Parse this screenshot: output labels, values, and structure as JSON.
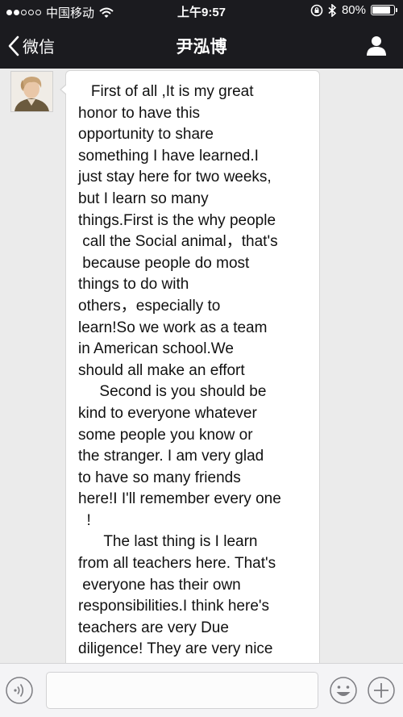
{
  "status_bar": {
    "carrier": "中国移动",
    "time": "上午9:57",
    "battery_percent": "80%",
    "battery_level": 0.8,
    "signal_icon": "signal-dots-icon",
    "wifi_icon": "wifi-icon",
    "orientation_lock_icon": "orientation-lock-icon",
    "bluetooth_icon": "bluetooth-icon"
  },
  "nav": {
    "back_label": "微信",
    "title": "尹泓博",
    "back_icon": "chevron-left-icon",
    "profile_icon": "person-icon"
  },
  "chat": {
    "messages": [
      {
        "sender": "other",
        "avatar_icon": "avatar-portrait",
        "text": "   First of all ,It is my great\nhonor to have this\nopportunity to share\nsomething I have learned.I\njust stay here for two weeks,\nbut I learn so many\nthings.First is the why people\n call the Social animal，that's\n because people do most\nthings to do with\nothers，especially to\nlearn!So we work as a team\nin American school.We\nshould all make an effort\n     Second is you should be\nkind to everyone whatever\nsome people you know or\nthe stranger. I am very glad\nto have so many friends\nhere!I I'll remember every one\n  !\n      The last thing is I learn\nfrom all teachers here. That's\n everyone has their own\nresponsibilities.I think here's\nteachers are very Due\ndiligence! They are very nice"
      }
    ]
  },
  "input_bar": {
    "voice_icon": "voice-icon",
    "emoji_icon": "emoji-icon",
    "plus_icon": "plus-icon",
    "input_value": ""
  },
  "colors": {
    "header_bg": "#1b1b1f",
    "chat_bg": "#ebebeb",
    "bubble_bg": "#ffffff",
    "input_bar_bg": "#f4f4f6"
  }
}
